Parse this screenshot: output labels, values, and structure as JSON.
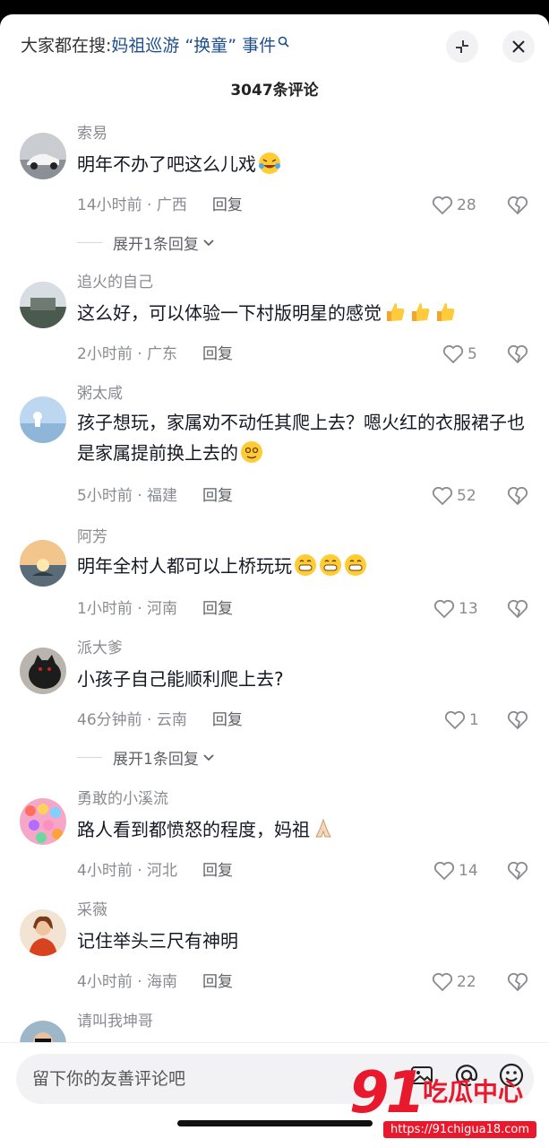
{
  "header": {
    "search_prefix": "大家都在搜:",
    "search_topic": "妈祖巡游 “换童” 事件",
    "comment_count": "3047条评论"
  },
  "comments": [
    {
      "username": "索易",
      "text": "明年不办了吧这么儿戏",
      "emoji": "crying-laughing",
      "time_location": "14小时前 · 广西",
      "reply_label": "回复",
      "likes": "28",
      "expand_label": "展开1条回复"
    },
    {
      "username": "追火的自己",
      "text": "这么好，可以体验一下村版明星的感觉",
      "emoji": "thumbs-up x3",
      "time_location": "2小时前 · 广东",
      "reply_label": "回复",
      "likes": "5"
    },
    {
      "username": "粥太咸",
      "text": "孩子想玩，家属劝不动任其爬上去？嗯火红的衣服裙子也是家属提前换上去的",
      "emoji": "dizzy-face",
      "time_location": "5小时前 · 福建",
      "reply_label": "回复",
      "likes": "52"
    },
    {
      "username": "阿芳",
      "text": "明年全村人都可以上桥玩玩",
      "emoji": "grinning x3",
      "time_location": "1小时前 · 河南",
      "reply_label": "回复",
      "likes": "13"
    },
    {
      "username": "派大爹",
      "text": "小孩子自己能顺利爬上去?",
      "time_location": "46分钟前 · 云南",
      "reply_label": "回复",
      "likes": "1",
      "expand_label": "展开1条回复"
    },
    {
      "username": "勇敢的小溪流",
      "text": "路人看到都愤怒的程度，妈祖",
      "emoji": "folded-hands",
      "time_location": "4小时前 · 河北",
      "reply_label": "回复",
      "likes": "14"
    },
    {
      "username": "采薇",
      "text": "记住举头三尺有神明",
      "time_location": "4小时前 · 海南",
      "reply_label": "回复",
      "likes": "22"
    },
    {
      "username": "请叫我坤哥"
    }
  ],
  "bottom": {
    "input_placeholder": "留下你的友善评论吧"
  },
  "watermark": {
    "number": "91",
    "title": "吃瓜中心",
    "url": "https://91chigua18.com"
  },
  "colors": {
    "accent_link": "#1f4f8f",
    "watermark_red": "#e8192c"
  }
}
